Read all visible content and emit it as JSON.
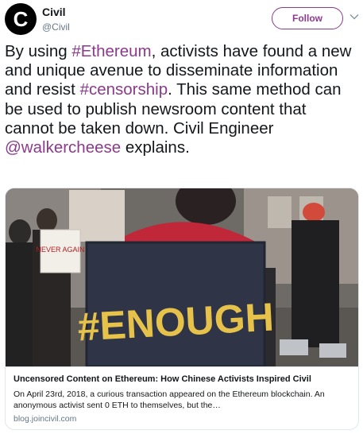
{
  "account": {
    "avatar_letter": "C",
    "name": "Civil",
    "handle": "@Civil",
    "follow_label": "Follow"
  },
  "tweet": {
    "t1": "By using ",
    "hashtag_ethereum": "#Ethereum",
    "t2": ", activists have found a new and unique avenue to disseminate information and resist ",
    "hashtag_censorship": "#censorship",
    "t3": ". This same method can be used to publish newsroom content that cannot be taken down. Civil Engineer ",
    "mention": "@walkercheese",
    "t4": " explains."
  },
  "card": {
    "image_sign_text": "#ENOUGH",
    "image_poster_text": "NEVER AGAIN",
    "title": "Uncensored Content on Ethereum: How Chinese Activists Inspired Civil",
    "description": "On April 23rd, 2018, a curious transaction appeared on the Ethereum blockchain. An anonymous activist sent 0 ETH to themselves, but the…",
    "domain": "blog.joincivil.com"
  },
  "colors": {
    "accent": "#8c3a8c",
    "text": "#14171a",
    "secondary": "#657786",
    "border": "#e1e8ed"
  }
}
